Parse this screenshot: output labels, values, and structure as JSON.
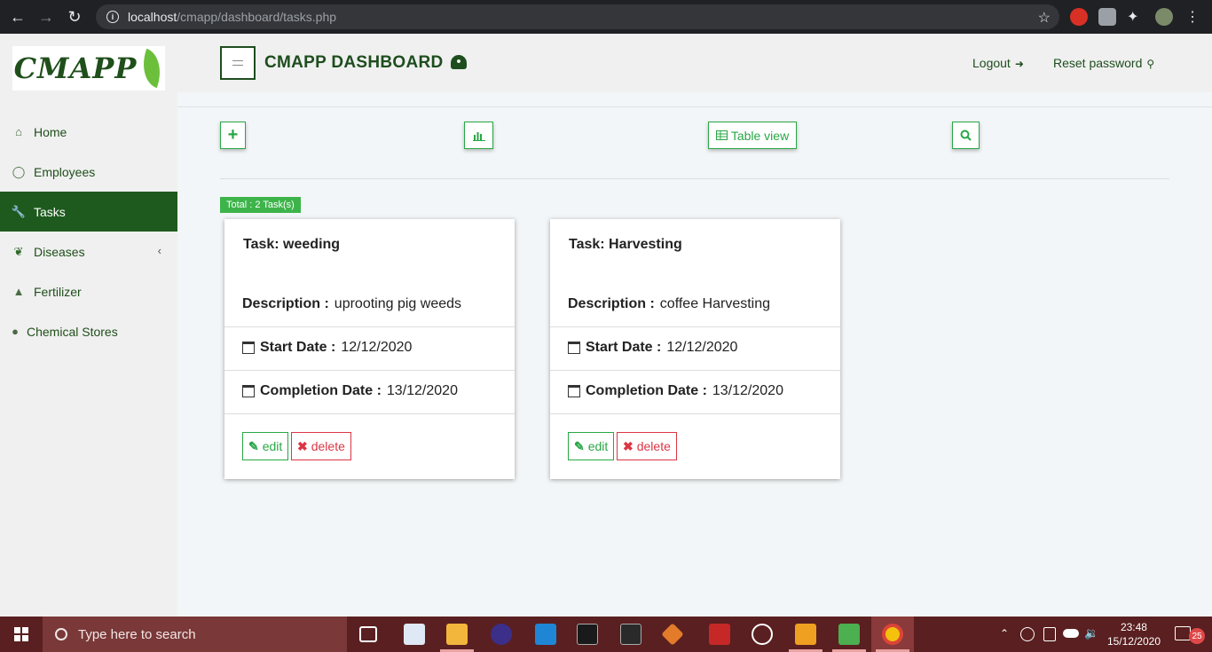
{
  "browser": {
    "url_host": "localhost",
    "url_path": "/cmapp/dashboard/tasks.php"
  },
  "sidebar": {
    "logo_text": "CMAPP",
    "items": [
      {
        "label": "Home",
        "icon": "home-icon"
      },
      {
        "label": "Employees",
        "icon": "user-icon"
      },
      {
        "label": "Tasks",
        "icon": "wrench-icon",
        "active": true
      },
      {
        "label": "Diseases",
        "icon": "leaf-icon",
        "has_submenu": true
      },
      {
        "label": "Fertilizer",
        "icon": "flask-icon"
      },
      {
        "label": "Chemical Stores",
        "icon": "map-marker-icon"
      }
    ]
  },
  "header": {
    "title": "CMAPP DASHBOARD",
    "logout_label": "Logout",
    "reset_password_label": "Reset password"
  },
  "toolbar": {
    "add_icon": "+",
    "chart_icon": "bar-chart-icon",
    "table_view_label": "Table view",
    "search_icon": "search-icon"
  },
  "summary": {
    "total_label": "Total : 2 Task(s)"
  },
  "tasks": [
    {
      "title": "Task: weeding",
      "description_label": "Description :",
      "description": "uprooting pig weeds",
      "start_label": "Start Date :",
      "start_date": "12/12/2020",
      "completion_label": "Completion Date :",
      "completion_date": "13/12/2020",
      "edit_label": "edit",
      "delete_label": "delete"
    },
    {
      "title": "Task: Harvesting",
      "description_label": "Description :",
      "description": "coffee Harvesting",
      "start_label": "Start Date :",
      "start_date": "12/12/2020",
      "completion_label": "Completion Date :",
      "completion_date": "13/12/2020",
      "edit_label": "edit",
      "delete_label": "delete"
    }
  ],
  "taskbar": {
    "search_placeholder": "Type here to search",
    "time": "23:48",
    "date": "15/12/2020",
    "notification_count": "25"
  },
  "colors": {
    "brand_green": "#1e4d1e",
    "active_bg": "#1e5a1e",
    "button_green": "#28a745",
    "delete_red": "#dc3545",
    "taskbar": "#5a1f20"
  }
}
